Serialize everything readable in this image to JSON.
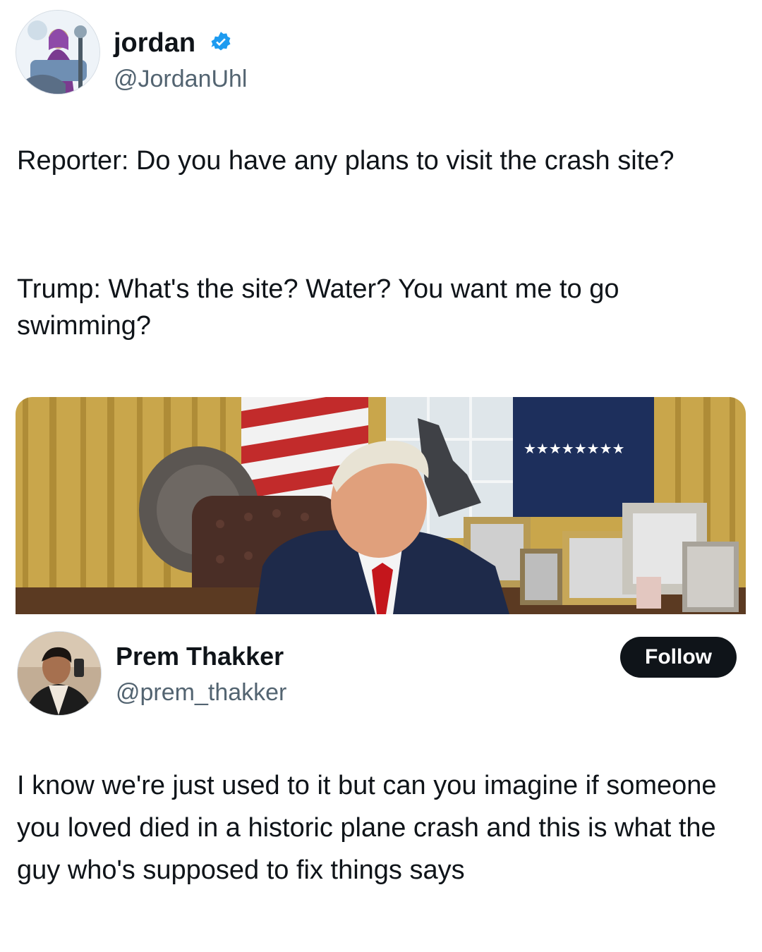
{
  "post": {
    "author_name": "jordan",
    "author_handle": "@JordanUhl",
    "verified_icon": "verified-badge-icon",
    "verified_color": "#1d9bf0",
    "text_line1": "Reporter: Do you have any plans to visit the crash site?",
    "text_line2": "Trump: What's the site? Water? You want me to go swimming?"
  },
  "quote": {
    "author_name": "Prem Thakker",
    "author_handle": "@prem_thakker",
    "follow_label": "Follow",
    "text": "I know we're just used to it but can you imagine if someone you loved died in a historic plane crash and this is what the guy who's supposed to fix things says"
  },
  "colors": {
    "text": "#0f1419",
    "secondary": "#536471",
    "button_bg": "#0f1419",
    "button_text": "#ffffff"
  }
}
